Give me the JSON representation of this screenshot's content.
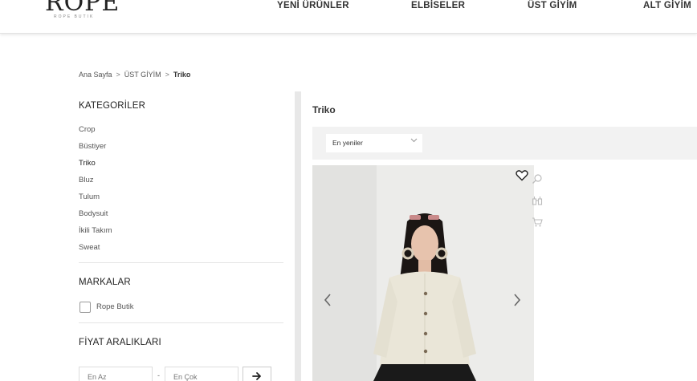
{
  "header": {
    "logo": "ROPE",
    "logo_sub": "ROPE BUTIK",
    "nav": [
      "YENİ ÜRÜNLER",
      "ELBİSELER",
      "ÜST GİYİM",
      "ALT GİYİM"
    ]
  },
  "breadcrumb": {
    "home": "Ana Sayfa",
    "sep": ">",
    "parent": "ÜST GİYİM",
    "current": "Triko"
  },
  "sidebar": {
    "categories_title": "KATEGORİLER",
    "categories": [
      "Crop",
      "Büstiyer",
      "Triko",
      "Bluz",
      "Tulum",
      "Bodysuit",
      "İkili Takım",
      "Sweat"
    ],
    "active_category": "Triko",
    "brands_title": "MARKALAR",
    "brands": [
      "Rope Butik"
    ],
    "price_title": "FİYAT ARALIKLARI",
    "price_min_placeholder": "En Az",
    "price_max_placeholder": "En Çok",
    "price_dash": "-"
  },
  "main": {
    "title": "Triko",
    "sort_selected": "En yeniler"
  },
  "icons": {
    "favorite": "heart-icon",
    "search": "search-icon",
    "compare": "compare-icon",
    "cart": "cart-icon",
    "prev": "chevron-left-icon",
    "next": "chevron-right-icon",
    "submit": "arrow-right-icon"
  },
  "colors": {
    "text": "#333333",
    "sort_bar": "#f2f2f2",
    "divider": "#e5e5e5"
  }
}
